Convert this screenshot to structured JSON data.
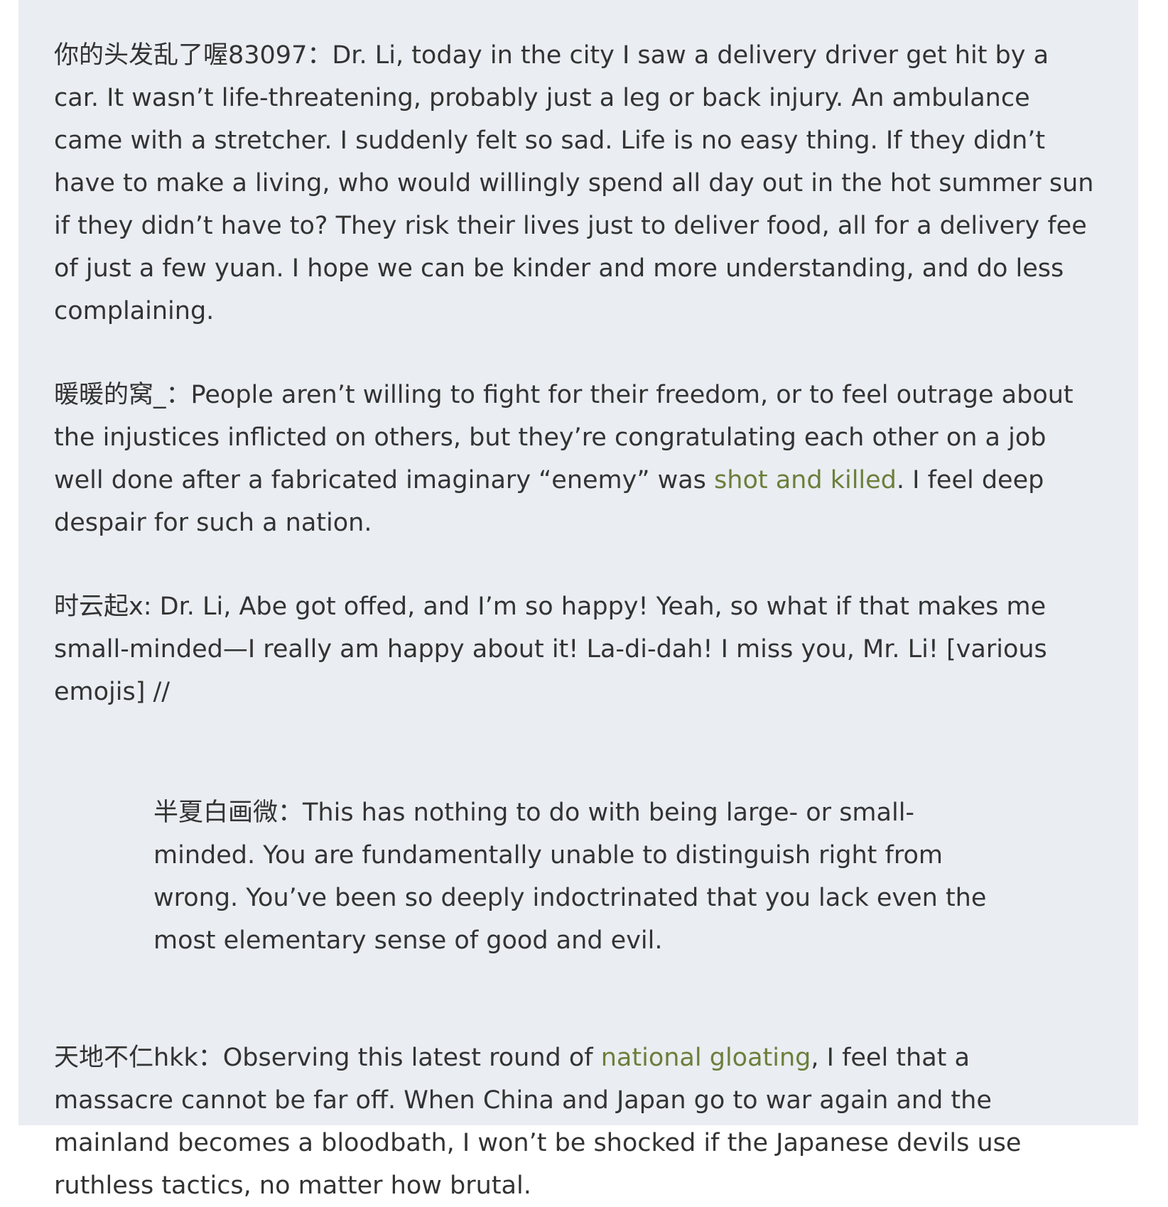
{
  "colors": {
    "panel_background": "#eaedf2",
    "text": "#333333",
    "link": "#6b7f3a"
  },
  "comments": [
    {
      "author": "你的头发乱了喔83097",
      "separator": "：",
      "text": "Dr. Li, today in the city I saw a delivery driver get hit by a car. It wasn’t life-threatening, probably just a leg or back injury. An ambulance came with a stretcher. I suddenly felt so sad. Life is no easy thing. If they didn’t have to make a living, who would willingly spend all day out in the hot summer sun if they didn’t have to? They risk their lives just to deliver food, all for a delivery fee of just a few yuan. I hope we can be kinder and more understanding, and do less complaining."
    },
    {
      "author": "暖暖的窝_",
      "separator": "：",
      "text_before": "People aren’t willing to fight for their freedom, or to feel outrage about the injustices inflicted on others, but they’re congratulating each other on a job well done after a fabricated imaginary “enemy” was ",
      "link": "shot and killed",
      "text_after": ". I feel deep despair for such a nation."
    },
    {
      "author": "时云起x",
      "separator": ": ",
      "text": "Dr. Li, Abe got offed, and I’m so happy! Yeah, so what if that makes me small-minded—I really am happy about it! La-di-dah! I miss you, Mr. Li! [various emojis] //"
    },
    {
      "author": "半夏白画微",
      "separator": "：",
      "text": "This has nothing to do with being large- or small-minded. You are fundamentally unable to distinguish right from wrong. You’ve been so deeply indoctrinated that you lack even the most elementary sense of good and evil."
    },
    {
      "author": "天地不仁hkk",
      "separator": "：",
      "text_before": "Observing this latest round of ",
      "link": "national gloating",
      "text_after": ", I feel that a massacre cannot be far off. When China and Japan go to war again and the mainland becomes a bloodbath, I won’t be shocked if the Japanese devils use ruthless tactics, no matter how brutal."
    }
  ]
}
